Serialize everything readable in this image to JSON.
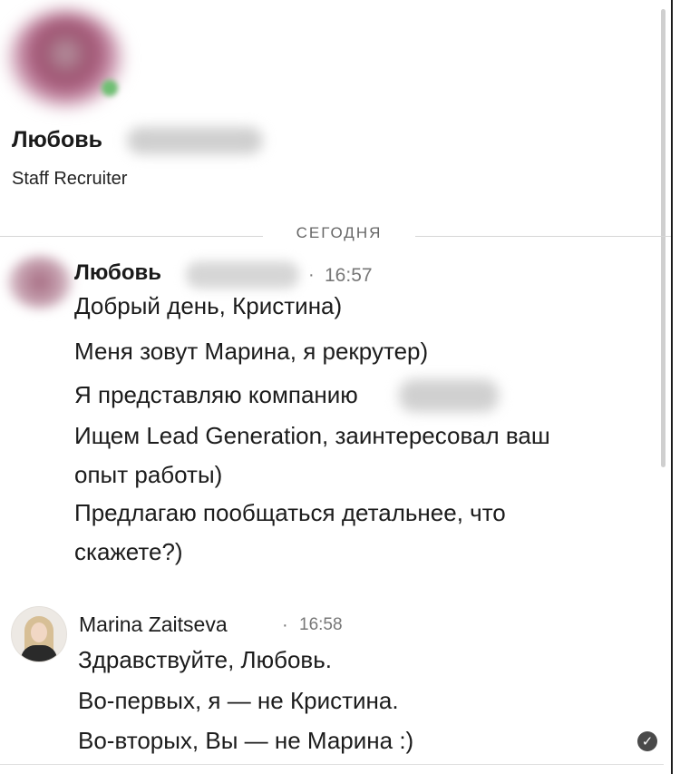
{
  "profile": {
    "name": "Любовь",
    "title": "Staff Recruiter"
  },
  "divider_label": "СЕГОДНЯ",
  "messages": [
    {
      "author": "Любовь",
      "separator": "·",
      "time": "16:57",
      "lines": [
        "Добрый день, Кристина)",
        "Меня зовут Марина, я рекрутер)",
        "Я представляю компанию",
        "Ищем Lead Generation, заинтересовал ваш",
        "опыт работы)",
        "Предлагаю пообщаться детальнее, что",
        "скажете?)"
      ]
    },
    {
      "author": "Marina Zaitseva",
      "separator": "·",
      "time": "16:58",
      "lines": [
        "Здравствуйте, Любовь.",
        "Во-первых, я — не Кристина.",
        "Во-вторых, Вы — не Марина :)"
      ]
    }
  ],
  "icons": {
    "read_receipt": "check-circle-icon",
    "read_receipt_glyph": "✓"
  }
}
